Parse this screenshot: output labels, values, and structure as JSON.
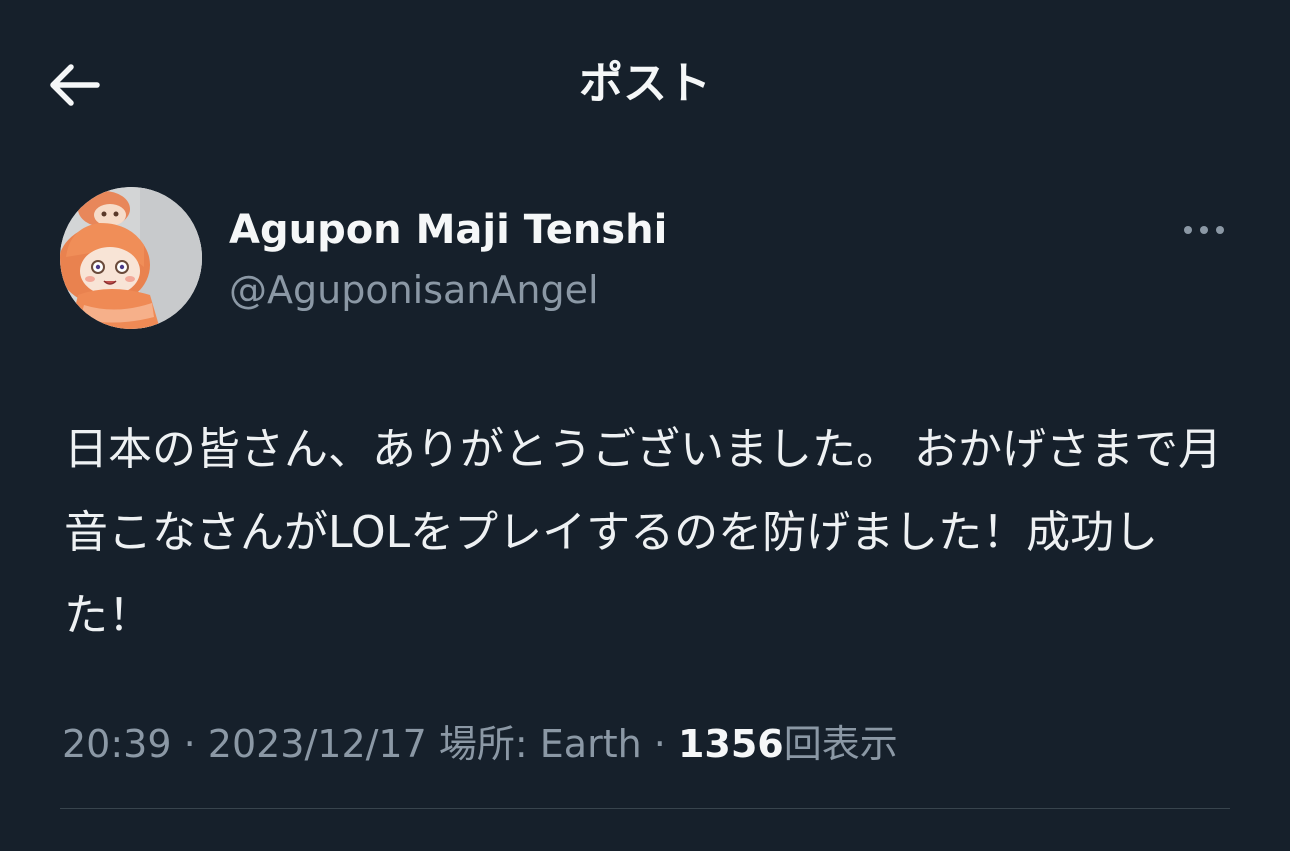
{
  "header": {
    "title": "ポスト",
    "back_icon": "arrow-left-icon"
  },
  "post": {
    "author": {
      "display_name": "Agupon Maji Tenshi",
      "handle": "@AguponisanAngel",
      "avatar_icon": "plush-doll-avatar"
    },
    "more_icon": "more-dots-icon",
    "text": "日本の皆さん、ありがとうございました。 おかげさまで月音こなさんがLOLをプレイするのを防げました！成功した！",
    "meta": {
      "time": "20:39",
      "separator": " · ",
      "date": "2023/12/17",
      "location_label": "場所: Earth",
      "views_count": "1356",
      "views_label": "回表示"
    }
  },
  "colors": {
    "background": "#16202b",
    "text_primary": "#f5f7f8",
    "text_secondary": "#8b98a5",
    "divider": "#38444d"
  }
}
